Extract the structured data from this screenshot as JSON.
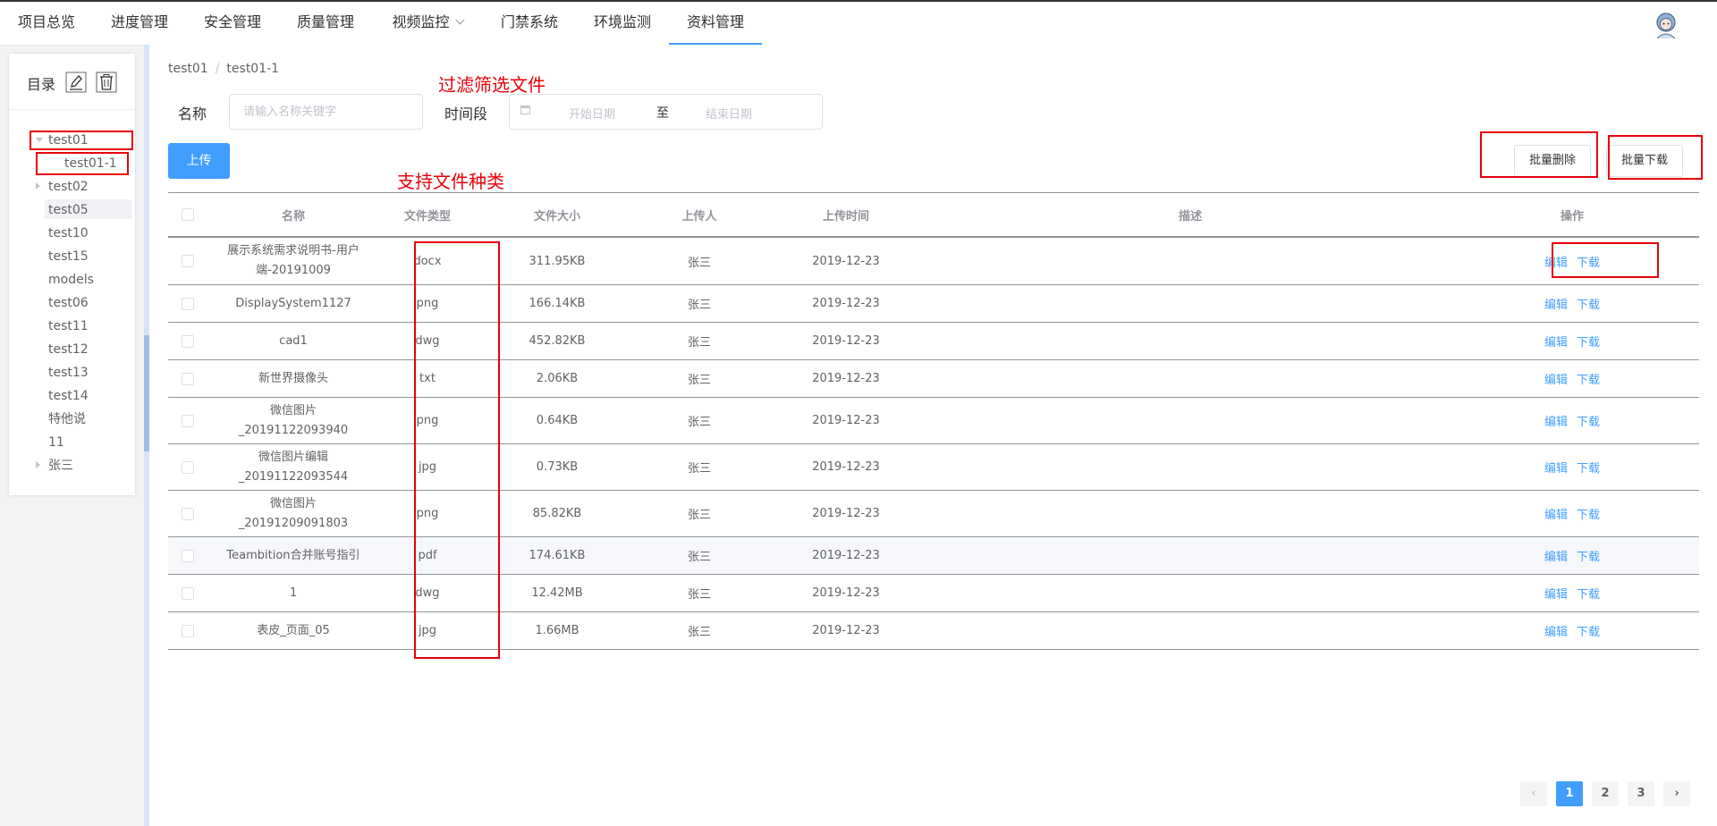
{
  "nav": {
    "items": [
      {
        "label": "项目总览"
      },
      {
        "label": "进度管理"
      },
      {
        "label": "安全管理"
      },
      {
        "label": "质量管理"
      },
      {
        "label": "视频监控"
      },
      {
        "label": "门禁系统"
      },
      {
        "label": "环境监测"
      },
      {
        "label": "资料管理"
      }
    ],
    "active": "资料管理"
  },
  "sidebar": {
    "title": "目录",
    "tree": [
      {
        "label": "test01"
      },
      {
        "label": "test01-1"
      },
      {
        "label": "test02"
      },
      {
        "label": "test05"
      },
      {
        "label": "test10"
      },
      {
        "label": "test15"
      },
      {
        "label": "models"
      },
      {
        "label": "test06"
      },
      {
        "label": "test11"
      },
      {
        "label": "test12"
      },
      {
        "label": "test13"
      },
      {
        "label": "test14"
      },
      {
        "label": "特他说"
      },
      {
        "label": "11"
      },
      {
        "label": "张三"
      }
    ]
  },
  "breadcrumb": {
    "parent": "test01",
    "separator": "/",
    "current": "test01-1"
  },
  "filters": {
    "name_label": "名称",
    "name_placeholder": "请输入名称关键字",
    "time_label": "时间段",
    "start_placeholder": "开始日期",
    "range_separator": "至",
    "end_placeholder": "结束日期"
  },
  "toolbar": {
    "upload": "上传",
    "batch_delete": "批量删除",
    "batch_download": "批量下载"
  },
  "annotations": {
    "filter_note": "过滤筛选文件",
    "types_note": "支持文件种类"
  },
  "table": {
    "headers": {
      "name": "名称",
      "type": "文件类型",
      "size": "文件大小",
      "uploader": "上传人",
      "time": "上传时间",
      "desc": "描述",
      "ops": "操作"
    },
    "rows": [
      {
        "name": "展示系统需求说明书-用户端-20191009",
        "type": "docx",
        "size": "311.95KB",
        "uploader": "张三",
        "time": "2019-12-23",
        "desc": "",
        "edit": "编辑",
        "download": "下载"
      },
      {
        "name": "DisplaySystem1127",
        "type": "png",
        "size": "166.14KB",
        "uploader": "张三",
        "time": "2019-12-23",
        "desc": "",
        "edit": "编辑",
        "download": "下载"
      },
      {
        "name": "cad1",
        "type": "dwg",
        "size": "452.82KB",
        "uploader": "张三",
        "time": "2019-12-23",
        "desc": "",
        "edit": "编辑",
        "download": "下载"
      },
      {
        "name": "新世界摄像头",
        "type": "txt",
        "size": "2.06KB",
        "uploader": "张三",
        "time": "2019-12-23",
        "desc": "",
        "edit": "编辑",
        "download": "下载"
      },
      {
        "name": "微信图片_20191122093940",
        "type": "png",
        "size": "0.64KB",
        "uploader": "张三",
        "time": "2019-12-23",
        "desc": "",
        "edit": "编辑",
        "download": "下载"
      },
      {
        "name": "微信图片编辑_20191122093544",
        "type": "jpg",
        "size": "0.73KB",
        "uploader": "张三",
        "time": "2019-12-23",
        "desc": "",
        "edit": "编辑",
        "download": "下载"
      },
      {
        "name": "微信图片_20191209091803",
        "type": "png",
        "size": "85.82KB",
        "uploader": "张三",
        "time": "2019-12-23",
        "desc": "",
        "edit": "编辑",
        "download": "下载"
      },
      {
        "name": "Teambition合并账号指引",
        "type": "pdf",
        "size": "174.61KB",
        "uploader": "张三",
        "time": "2019-12-23",
        "desc": "",
        "edit": "编辑",
        "download": "下载"
      },
      {
        "name": "1",
        "type": "dwg",
        "size": "12.42MB",
        "uploader": "张三",
        "time": "2019-12-23",
        "desc": "",
        "edit": "编辑",
        "download": "下载"
      },
      {
        "name": "表皮_页面_05",
        "type": "jpg",
        "size": "1.66MB",
        "uploader": "张三",
        "time": "2019-12-23",
        "desc": "",
        "edit": "编辑",
        "download": "下载"
      }
    ]
  },
  "pagination": {
    "prev": "‹",
    "pages": [
      "1",
      "2",
      "3"
    ],
    "current": "1",
    "next": "›"
  },
  "colors": {
    "primary": "#409eff",
    "annotation": "#e8000b",
    "text": "#606266"
  }
}
